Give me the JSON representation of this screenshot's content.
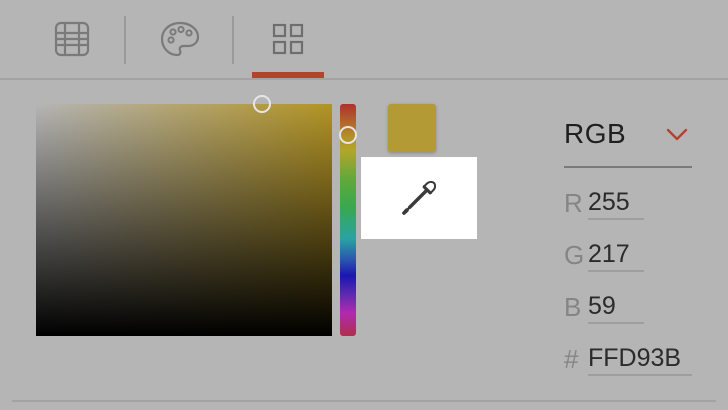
{
  "tabs": [
    {
      "icon": "table-grid-icon",
      "active": false
    },
    {
      "icon": "palette-icon",
      "active": false
    },
    {
      "icon": "grid-squares-icon",
      "active": true
    }
  ],
  "colors": {
    "accent": "#b0452e",
    "swatch": "#b39a34",
    "background": "#b5b5b5"
  },
  "picker": {
    "mode": "RGB",
    "channels": [
      {
        "label": "R",
        "value": "255"
      },
      {
        "label": "G",
        "value": "217"
      },
      {
        "label": "B",
        "value": "59"
      }
    ],
    "hex": {
      "label": "#",
      "value": "FFD93B"
    }
  }
}
